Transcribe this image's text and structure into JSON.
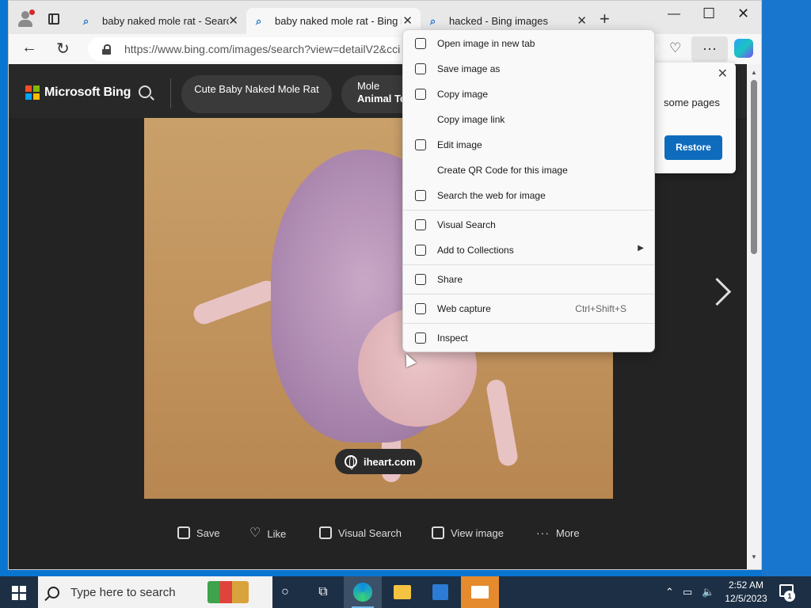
{
  "browser": {
    "tabs": [
      {
        "title": "baby naked mole rat - Search",
        "active": false
      },
      {
        "title": "baby naked mole rat - Bing images",
        "active": true
      },
      {
        "title": "hacked - Bing images",
        "active": false
      }
    ],
    "address_url": "https://www.bing.com/images/search?view=detailV2&cci"
  },
  "bing": {
    "brand": "Microsoft Bing",
    "chips": [
      {
        "label": "Cute Baby Naked Mole Rat"
      },
      {
        "line1": "Mole",
        "line2": "Animal Te"
      }
    ],
    "source": "iheart.com",
    "actions": [
      {
        "label": "Save",
        "icon": "save-icon"
      },
      {
        "label": "Like",
        "icon": "heart-icon"
      },
      {
        "label": "Visual Search",
        "icon": "visual-search-icon"
      },
      {
        "label": "View image",
        "icon": "view-image-icon"
      },
      {
        "label": "More",
        "icon": "more-dots-icon"
      }
    ]
  },
  "restore_popup": {
    "message": "some pages",
    "button": "Restore"
  },
  "context_menu": {
    "items": [
      {
        "label": "Open image in new tab",
        "icon": "new-tab-icon"
      },
      {
        "label": "Save image as",
        "icon": "save-image-icon"
      },
      {
        "label": "Copy image",
        "icon": "copy-image-icon"
      },
      {
        "label": "Copy image link",
        "icon": ""
      },
      {
        "label": "Edit image",
        "icon": "edit-image-icon"
      },
      {
        "label": "Create QR Code for this image",
        "icon": ""
      },
      {
        "label": "Search the web for image",
        "icon": "search-web-icon"
      },
      {
        "label": "Visual Search",
        "icon": "visual-search-icon"
      },
      {
        "label": "Add to Collections",
        "icon": "collections-icon"
      },
      {
        "label": "Share",
        "icon": "share-icon"
      },
      {
        "label": "Web capture",
        "icon": "web-capture-icon",
        "shortcut": "Ctrl+Shift+S"
      },
      {
        "label": "Inspect",
        "icon": "inspect-icon"
      }
    ]
  },
  "taskbar": {
    "search_placeholder": "Type here to search",
    "time": "2:52 AM",
    "date": "12/5/2023",
    "notification_count": "1"
  },
  "colors": {
    "accent": "#0f6cbd",
    "taskbar": "#1c2f44",
    "page_bg": "#232323"
  }
}
